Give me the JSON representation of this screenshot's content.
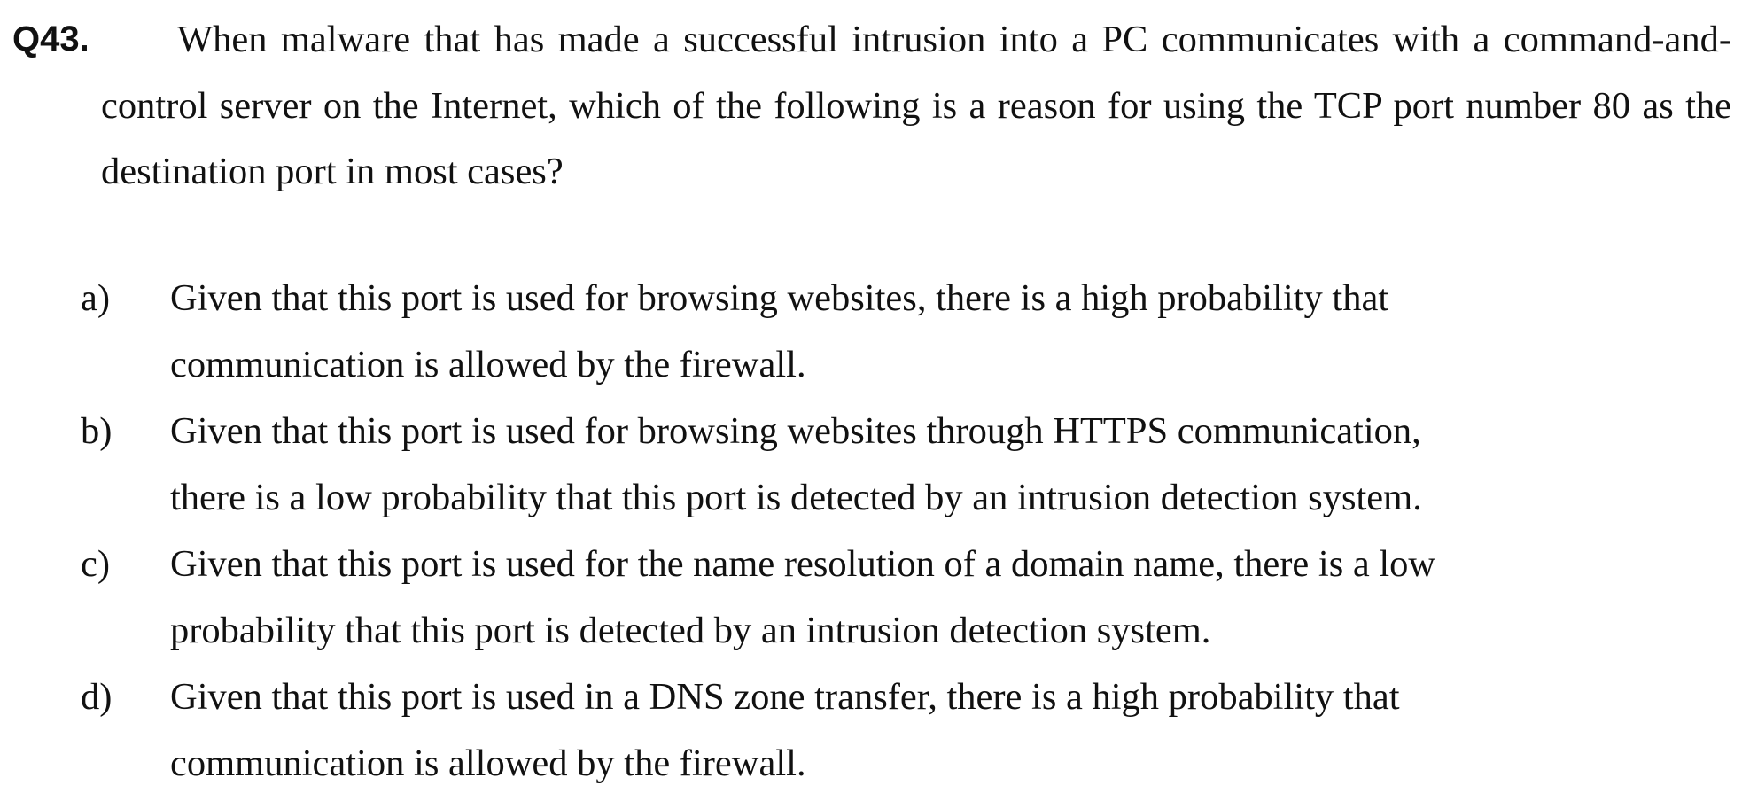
{
  "question": {
    "number": "Q43.",
    "text": "When malware that has made a successful intrusion into a PC communicates with a command-and-control server on the Internet, which of the following is a reason for using the TCP port number 80 as the destination port in most cases?"
  },
  "options": [
    {
      "letter": "a)",
      "line1": "Given that this port is used for browsing websites, there is a high probability that",
      "line2": "communication is allowed by the firewall."
    },
    {
      "letter": "b)",
      "line1": "Given that this port is used for browsing websites through HTTPS communication,",
      "line2": "there is a low probability that this port is detected by an intrusion detection system."
    },
    {
      "letter": "c)",
      "line1": "Given that this port is used for the name resolution of a domain name, there is a low",
      "line2": "probability that this port is detected by an intrusion detection system."
    },
    {
      "letter": "d)",
      "line1": "Given that this port is used in a DNS zone transfer, there is a high probability that",
      "line2": "communication is allowed by the firewall."
    }
  ]
}
